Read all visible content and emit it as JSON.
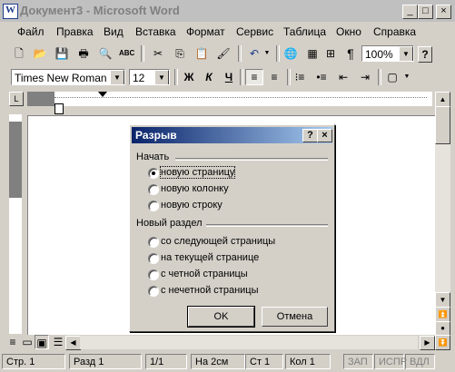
{
  "window": {
    "title": "Документ3 - Microsoft Word",
    "caption_buttons": [
      "_",
      "□",
      "×"
    ]
  },
  "menu": [
    "Файл",
    "Правка",
    "Вид",
    "Вставка",
    "Формат",
    "Сервис",
    "Таблица",
    "Окно",
    "Справка"
  ],
  "toolbar": {
    "zoom": "100%",
    "font": "Times New Roman",
    "size": "12",
    "bold": "Ж",
    "italic": "К",
    "underline": "Ч",
    "paragraph_mark": "¶",
    "help": "?"
  },
  "dialog": {
    "title": "Разрыв",
    "help_btn": "?",
    "close_btn": "×",
    "group1": "Начать",
    "options1": [
      "новую страницу",
      "новую колонку",
      "новую строку"
    ],
    "selected": "новую страницу",
    "group2": "Новый раздел",
    "options2": [
      "со следующей страницы",
      "на текущей странице",
      "с четной страницы",
      "с нечетной страницы"
    ],
    "ok": "OK",
    "cancel": "Отмена"
  },
  "status": {
    "page": "Стр. 1",
    "section": "Разд 1",
    "pages": "1/1",
    "at": "На 2см",
    "line": "Ст 1",
    "col": "Кол 1",
    "rec": "ЗАП",
    "trk": "ИСПР",
    "ext": "ВДЛ"
  },
  "colors": {
    "titlebar_inactive": "#c0c0c0",
    "dialog_title": "#0a246a",
    "face": "#d4d0c8"
  }
}
